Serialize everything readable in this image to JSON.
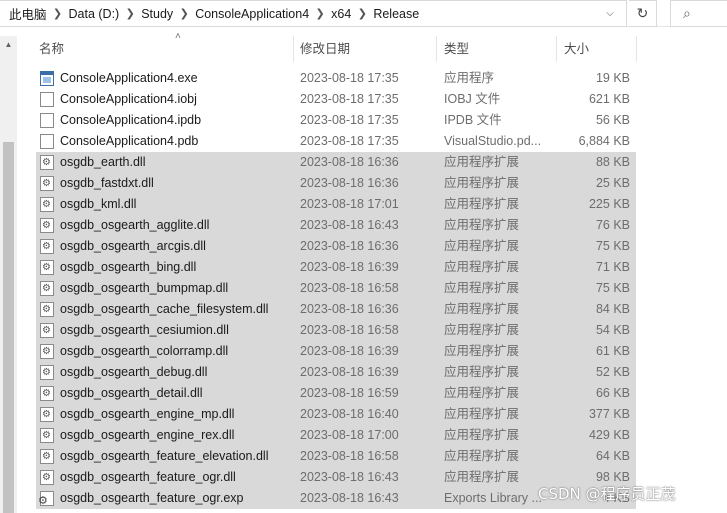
{
  "address_bar": {
    "crumbs": [
      "此电脑",
      "Data (D:)",
      "Study",
      "ConsoleApplication4",
      "x64",
      "Release"
    ]
  },
  "icons": {
    "crumb_separator": "chevron-right-icon",
    "dropdown": "chevron-down-icon",
    "refresh": "refresh-icon",
    "search": "search-icon"
  },
  "columns": {
    "name": "名称",
    "date": "修改日期",
    "type": "类型",
    "size": "大小"
  },
  "files": [
    {
      "name": "ConsoleApplication4.exe",
      "date": "2023-08-18 17:35",
      "type": "应用程序",
      "size": "19 KB",
      "icon": "exe-icon",
      "selected": false
    },
    {
      "name": "ConsoleApplication4.iobj",
      "date": "2023-08-18 17:35",
      "type": "IOBJ 文件",
      "size": "621 KB",
      "icon": "document-icon",
      "selected": false
    },
    {
      "name": "ConsoleApplication4.ipdb",
      "date": "2023-08-18 17:35",
      "type": "IPDB 文件",
      "size": "56 KB",
      "icon": "document-icon",
      "selected": false
    },
    {
      "name": "ConsoleApplication4.pdb",
      "date": "2023-08-18 17:35",
      "type": "VisualStudio.pd...",
      "size": "6,884 KB",
      "icon": "document-icon",
      "selected": false
    },
    {
      "name": "osgdb_earth.dll",
      "date": "2023-08-18 16:36",
      "type": "应用程序扩展",
      "size": "88 KB",
      "icon": "dll-icon",
      "selected": true
    },
    {
      "name": "osgdb_fastdxt.dll",
      "date": "2023-08-18 16:36",
      "type": "应用程序扩展",
      "size": "25 KB",
      "icon": "dll-icon",
      "selected": true
    },
    {
      "name": "osgdb_kml.dll",
      "date": "2023-08-18 17:01",
      "type": "应用程序扩展",
      "size": "225 KB",
      "icon": "dll-icon",
      "selected": true
    },
    {
      "name": "osgdb_osgearth_agglite.dll",
      "date": "2023-08-18 16:43",
      "type": "应用程序扩展",
      "size": "76 KB",
      "icon": "dll-icon",
      "selected": true
    },
    {
      "name": "osgdb_osgearth_arcgis.dll",
      "date": "2023-08-18 16:36",
      "type": "应用程序扩展",
      "size": "75 KB",
      "icon": "dll-icon",
      "selected": true
    },
    {
      "name": "osgdb_osgearth_bing.dll",
      "date": "2023-08-18 16:39",
      "type": "应用程序扩展",
      "size": "71 KB",
      "icon": "dll-icon",
      "selected": true
    },
    {
      "name": "osgdb_osgearth_bumpmap.dll",
      "date": "2023-08-18 16:58",
      "type": "应用程序扩展",
      "size": "75 KB",
      "icon": "dll-icon",
      "selected": true
    },
    {
      "name": "osgdb_osgearth_cache_filesystem.dll",
      "date": "2023-08-18 16:36",
      "type": "应用程序扩展",
      "size": "84 KB",
      "icon": "dll-icon",
      "selected": true
    },
    {
      "name": "osgdb_osgearth_cesiumion.dll",
      "date": "2023-08-18 16:58",
      "type": "应用程序扩展",
      "size": "54 KB",
      "icon": "dll-icon",
      "selected": true
    },
    {
      "name": "osgdb_osgearth_colorramp.dll",
      "date": "2023-08-18 16:39",
      "type": "应用程序扩展",
      "size": "61 KB",
      "icon": "dll-icon",
      "selected": true
    },
    {
      "name": "osgdb_osgearth_debug.dll",
      "date": "2023-08-18 16:39",
      "type": "应用程序扩展",
      "size": "52 KB",
      "icon": "dll-icon",
      "selected": true
    },
    {
      "name": "osgdb_osgearth_detail.dll",
      "date": "2023-08-18 16:59",
      "type": "应用程序扩展",
      "size": "66 KB",
      "icon": "dll-icon",
      "selected": true
    },
    {
      "name": "osgdb_osgearth_engine_mp.dll",
      "date": "2023-08-18 16:40",
      "type": "应用程序扩展",
      "size": "377 KB",
      "icon": "dll-icon",
      "selected": true
    },
    {
      "name": "osgdb_osgearth_engine_rex.dll",
      "date": "2023-08-18 17:00",
      "type": "应用程序扩展",
      "size": "429 KB",
      "icon": "dll-icon",
      "selected": true
    },
    {
      "name": "osgdb_osgearth_feature_elevation.dll",
      "date": "2023-08-18 16:58",
      "type": "应用程序扩展",
      "size": "64 KB",
      "icon": "dll-icon",
      "selected": true
    },
    {
      "name": "osgdb_osgearth_feature_ogr.dll",
      "date": "2023-08-18 16:43",
      "type": "应用程序扩展",
      "size": "98 KB",
      "icon": "dll-icon",
      "selected": true
    },
    {
      "name": "osgdb_osgearth_feature_ogr.exp",
      "date": "2023-08-18 16:43",
      "type": "Exports Library ...",
      "size": "4 KB",
      "icon": "exp-icon",
      "selected": true
    }
  ],
  "watermark": "CSDN @程序员正茂",
  "colors": {
    "selected_row": "#d9d9d9",
    "muted_text": "#6d6d6d"
  }
}
